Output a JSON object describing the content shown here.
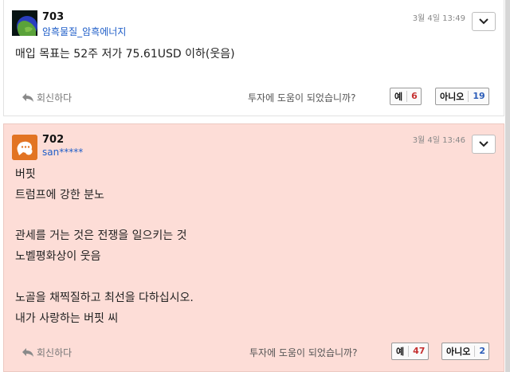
{
  "posts": [
    {
      "number": "703",
      "author": "암흑물질_암흑에너지",
      "date": "3월 4일 13:49",
      "content": "매입 목표는 52주 저가 75.61USD 이하(웃음)",
      "reply_label": "회신하다",
      "helpful_question": "투자에 도움이 되었습니까?",
      "yes_label": "예",
      "yes_count": "6",
      "no_label": "아니오",
      "no_count": "19",
      "avatar_icon": "planet-avatar-icon"
    },
    {
      "number": "702",
      "author": "san*****",
      "date": "3월 4일 13:46",
      "content": "버핏\n트럼프에 강한 분노\n\n관세를 거는 것은 전쟁을 일으키는 것\n노벨평화상이 웃음\n\n노골을 채찍질하고 최선을 다하십시오.\n내가 사랑하는 버핏 씨",
      "reply_label": "회신하다",
      "helpful_question": "투자에 도움이 되었습니까?",
      "yes_label": "예",
      "yes_count": "47",
      "no_label": "아니오",
      "no_count": "2",
      "avatar_icon": "speech-bubble-avatar-icon"
    }
  ],
  "colors": {
    "highlight_bg": "#fdddd7",
    "author_link": "#1f5ec8",
    "yes_count": "#c53030",
    "no_count": "#2b5cb8"
  }
}
